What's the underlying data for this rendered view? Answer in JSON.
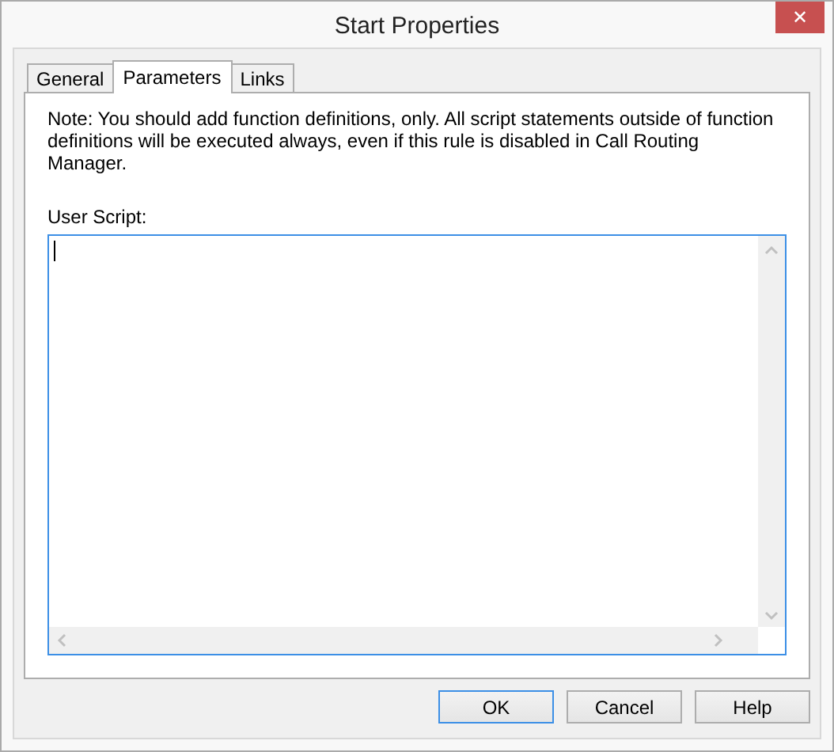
{
  "window": {
    "title": "Start Properties",
    "close": "✕"
  },
  "tabs": [
    {
      "label": "General",
      "selected": false
    },
    {
      "label": "Parameters",
      "selected": true
    },
    {
      "label": "Links",
      "selected": false
    }
  ],
  "note": "Note: You should add function definitions, only. All script statements outside of function definitions will be executed always, even if this rule is disabled in Call Routing Manager.",
  "script": {
    "label": "User Script:",
    "focused": true
  },
  "buttons": [
    {
      "label": "OK",
      "default": true
    },
    {
      "label": "Cancel",
      "default": false
    },
    {
      "label": "Help",
      "default": false
    }
  ]
}
